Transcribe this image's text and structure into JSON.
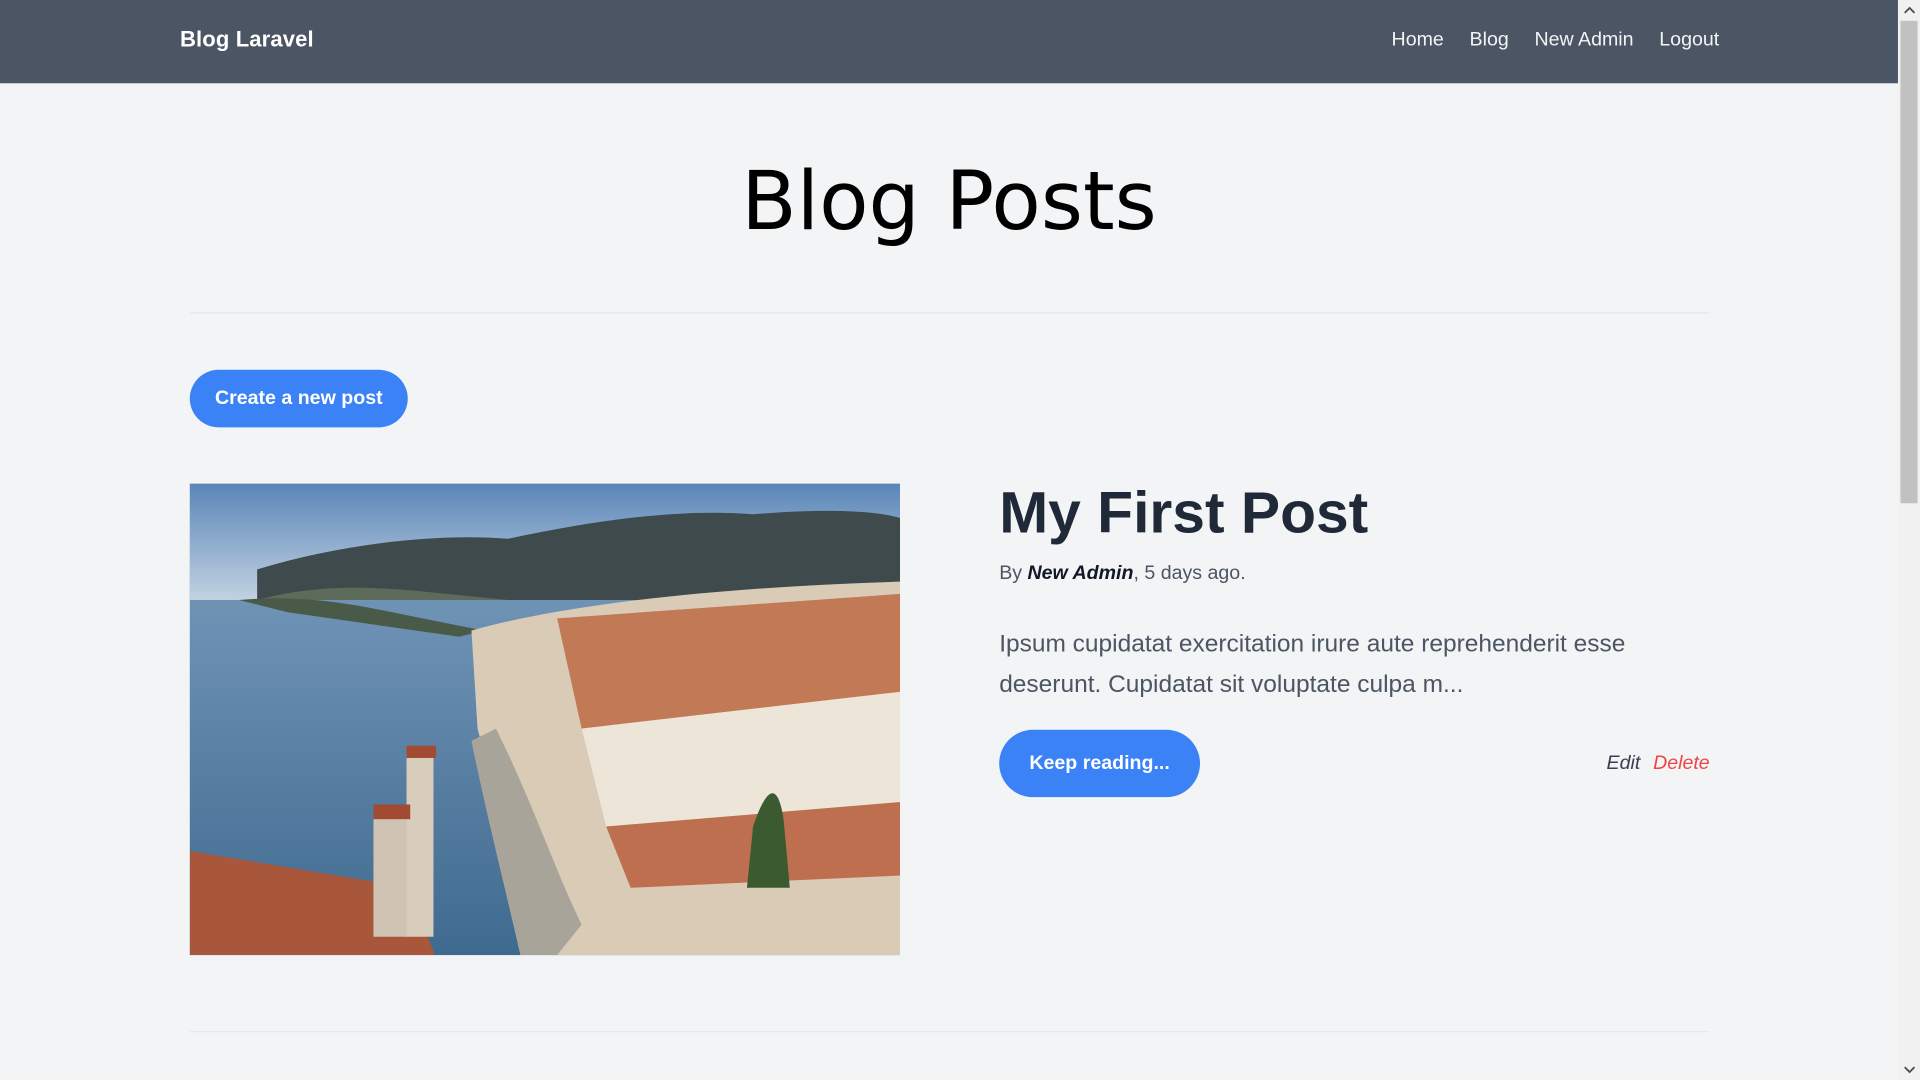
{
  "navbar": {
    "brand": "Blog Laravel",
    "links": [
      "Home",
      "Blog",
      "New Admin",
      "Logout"
    ]
  },
  "page": {
    "title": "Blog Posts",
    "create_button": "Create a new post"
  },
  "post": {
    "title": "My First Post",
    "meta_prefix": "By ",
    "author": "New Admin",
    "meta_suffix": ", 5 days ago.",
    "excerpt": "Ipsum cupidatat exercitation irure aute reprehenderit esse deserunt. Cupidatat sit voluptate culpa m...",
    "read_more": "Keep reading...",
    "edit": "Edit",
    "delete": "Delete"
  },
  "colors": {
    "navbar": "#4b5563",
    "accent": "#3b82f6",
    "danger": "#ef4444",
    "background": "#f3f4f6"
  },
  "icons": {
    "scroll_up": "chevron-up-icon",
    "scroll_down": "chevron-down-icon"
  }
}
